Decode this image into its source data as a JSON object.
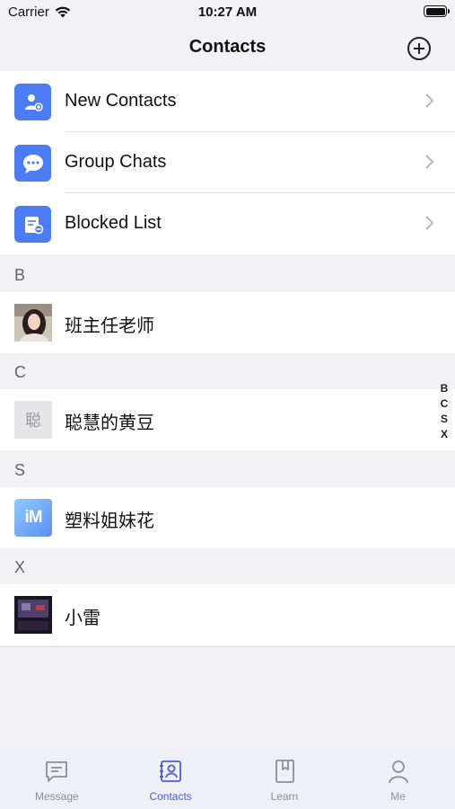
{
  "status_bar": {
    "carrier": "Carrier",
    "time": "10:27 AM"
  },
  "nav": {
    "title": "Contacts"
  },
  "menu": [
    {
      "label": "New Contacts",
      "icon": "new-contact-icon"
    },
    {
      "label": "Group Chats",
      "icon": "group-chat-icon"
    },
    {
      "label": "Blocked List",
      "icon": "blocked-list-icon"
    }
  ],
  "sections": [
    {
      "letter": "B",
      "contacts": [
        {
          "name": "班主任老师",
          "avatar": "photo"
        }
      ]
    },
    {
      "letter": "C",
      "contacts": [
        {
          "name": "聪慧的黄豆",
          "avatar_text": "聪"
        }
      ]
    },
    {
      "letter": "S",
      "contacts": [
        {
          "name": "塑料姐妹花",
          "avatar_text": "iM"
        }
      ]
    },
    {
      "letter": "X",
      "contacts": [
        {
          "name": "小雷",
          "avatar": "photo"
        }
      ]
    }
  ],
  "index": [
    "B",
    "C",
    "S",
    "X"
  ],
  "tabs": [
    {
      "label": "Message",
      "icon": "message-icon",
      "active": false
    },
    {
      "label": "Contacts",
      "icon": "contacts-icon",
      "active": true
    },
    {
      "label": "Learn",
      "icon": "book-icon",
      "active": false
    },
    {
      "label": "Me",
      "icon": "person-icon",
      "active": false
    }
  ],
  "colors": {
    "accent": "#4b5be0",
    "menu_icon_bg": "#4b7cf3",
    "background": "#f2f2f6"
  }
}
